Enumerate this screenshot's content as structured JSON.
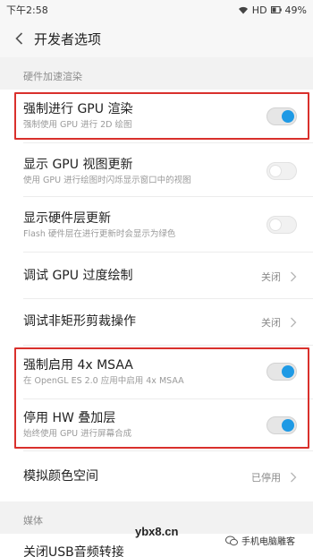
{
  "status_bar": {
    "time": "下午2:58",
    "network": "HD",
    "battery": "49%",
    "icons": [
      "wifi-icon",
      "battery-icon"
    ]
  },
  "header": {
    "title": "开发者选项",
    "back_icon": "chevron-left-icon"
  },
  "sections": {
    "hw_accel_label": "硬件加速渲染",
    "media_label": "媒体"
  },
  "settings": {
    "force_gpu": {
      "title": "强制进行 GPU 渲染",
      "subtitle": "强制使用 GPU 进行 2D 绘图",
      "enabled": true
    },
    "gpu_view_updates": {
      "title": "显示 GPU 视图更新",
      "subtitle": "使用 GPU 进行绘图时闪烁显示窗口中的视图",
      "enabled": false
    },
    "hw_layer_updates": {
      "title": "显示硬件层更新",
      "subtitle": "Flash 硬件层在进行更新时会显示为绿色",
      "enabled": false
    },
    "gpu_overdraw": {
      "title": "调试 GPU 过度绘制",
      "value": "关闭"
    },
    "non_rect_clip": {
      "title": "调试非矩形剪裁操作",
      "value": "关闭"
    },
    "force_msaa": {
      "title": "强制启用 4x MSAA",
      "subtitle": "在 OpenGL ES 2.0 应用中启用 4x MSAA",
      "enabled": true
    },
    "disable_hw_overlays": {
      "title": "停用 HW 叠加层",
      "subtitle": "始终使用 GPU 进行屏幕合成",
      "enabled": true
    },
    "simulate_color_space": {
      "title": "模拟颜色空间",
      "value": "已停用"
    },
    "usb_audio": {
      "title": "关闭USB音频转接"
    }
  },
  "colors": {
    "accent": "#1f9ae5",
    "highlight_border": "#d9302c",
    "section_bg": "#f2f2f2"
  },
  "watermarks": {
    "site": "ybx8.cn",
    "account": "手机电脑雕客",
    "account_icon": "wechat-icon"
  }
}
